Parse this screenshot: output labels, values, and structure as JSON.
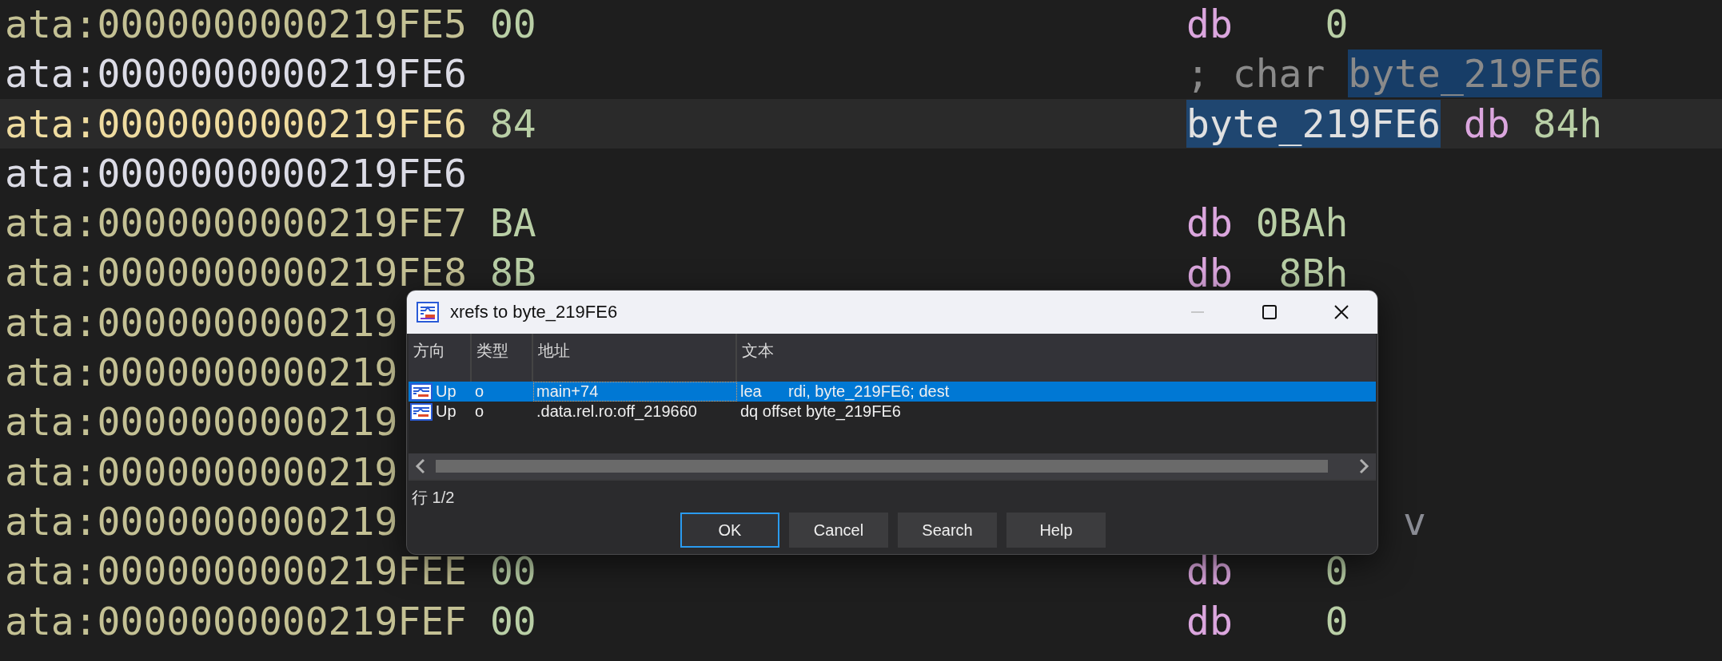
{
  "listing": [
    {
      "address": "ata:0000000000219FE5",
      "kind": "data",
      "current": false,
      "bytes": "00",
      "code": [
        {
          "text": "db",
          "kind": "keyword",
          "highlighted": false
        },
        {
          "text": "    0",
          "kind": "number",
          "highlighted": false
        }
      ]
    },
    {
      "address": "ata:0000000000219FE6",
      "kind": "label",
      "current": false,
      "code": [
        {
          "text": "; char ",
          "kind": "comment",
          "highlighted": false
        },
        {
          "text": "byte_219FE6",
          "kind": "comment",
          "highlighted": true
        }
      ]
    },
    {
      "address": "ata:0000000000219FE6",
      "kind": "data",
      "current": true,
      "bytes": "84",
      "code": [
        {
          "text": "byte_219FE6",
          "kind": "symbol",
          "highlighted": true
        },
        {
          "text": " db",
          "kind": "keyword",
          "highlighted": false
        },
        {
          "text": " 84h",
          "kind": "number",
          "highlighted": false
        }
      ]
    },
    {
      "address": "ata:0000000000219FE6",
      "kind": "label",
      "current": false
    },
    {
      "address": "ata:0000000000219FE7",
      "kind": "data",
      "current": false,
      "bytes": "BA",
      "code": [
        {
          "text": "db",
          "kind": "keyword",
          "highlighted": false
        },
        {
          "text": " 0BAh",
          "kind": "number",
          "highlighted": false
        }
      ]
    },
    {
      "address": "ata:0000000000219FE8",
      "kind": "data",
      "current": false,
      "bytes": "8B",
      "code": [
        {
          "text": "db",
          "kind": "keyword",
          "highlighted": false
        },
        {
          "text": "  8Bh",
          "kind": "number",
          "highlighted": false
        }
      ]
    },
    {
      "address": "ata:0000000000219",
      "kind": "data",
      "current": false
    },
    {
      "address": "ata:0000000000219",
      "kind": "data",
      "current": false
    },
    {
      "address": "ata:0000000000219",
      "kind": "data",
      "current": false
    },
    {
      "address": "ata:0000000000219",
      "kind": "data",
      "current": false
    },
    {
      "address": "ata:0000000000219",
      "kind": "data",
      "current": false,
      "code": [
        {
          "text": "v",
          "kind": "comment-tail",
          "highlighted": false
        }
      ]
    },
    {
      "address": "ata:0000000000219FEE",
      "kind": "data",
      "current": false,
      "bytes": "00",
      "code": [
        {
          "text": "db",
          "kind": "keyword",
          "highlighted": false
        },
        {
          "text": "    0",
          "kind": "number",
          "highlighted": false
        }
      ]
    },
    {
      "address": "ata:0000000000219FEF",
      "kind": "data",
      "current": false,
      "bytes": "00",
      "code": [
        {
          "text": "db",
          "kind": "keyword",
          "highlighted": false
        },
        {
          "text": "    0",
          "kind": "number",
          "highlighted": false
        }
      ]
    }
  ],
  "dialog": {
    "title": "xrefs to byte_219FE6",
    "controls": [
      {
        "kind": "minimize",
        "disabled": true
      },
      {
        "kind": "maximize",
        "disabled": false
      },
      {
        "kind": "close",
        "disabled": false
      }
    ],
    "columns": [
      "方向",
      "类型",
      "地址",
      "文本"
    ],
    "rows": [
      {
        "direction": "Up",
        "type": "o",
        "address": "main+74",
        "text": "lea      rdi, byte_219FE6; dest",
        "selected": true
      },
      {
        "direction": "Up",
        "type": "o",
        "address": ".data.rel.ro:off_219660",
        "text": "dq offset byte_219FE6",
        "selected": false
      }
    ],
    "status": "行 1/2",
    "buttons": [
      {
        "label": "OK",
        "focused": true
      },
      {
        "label": "Cancel",
        "focused": false
      },
      {
        "label": "Search",
        "focused": false
      },
      {
        "label": "Help",
        "focused": false
      }
    ]
  }
}
